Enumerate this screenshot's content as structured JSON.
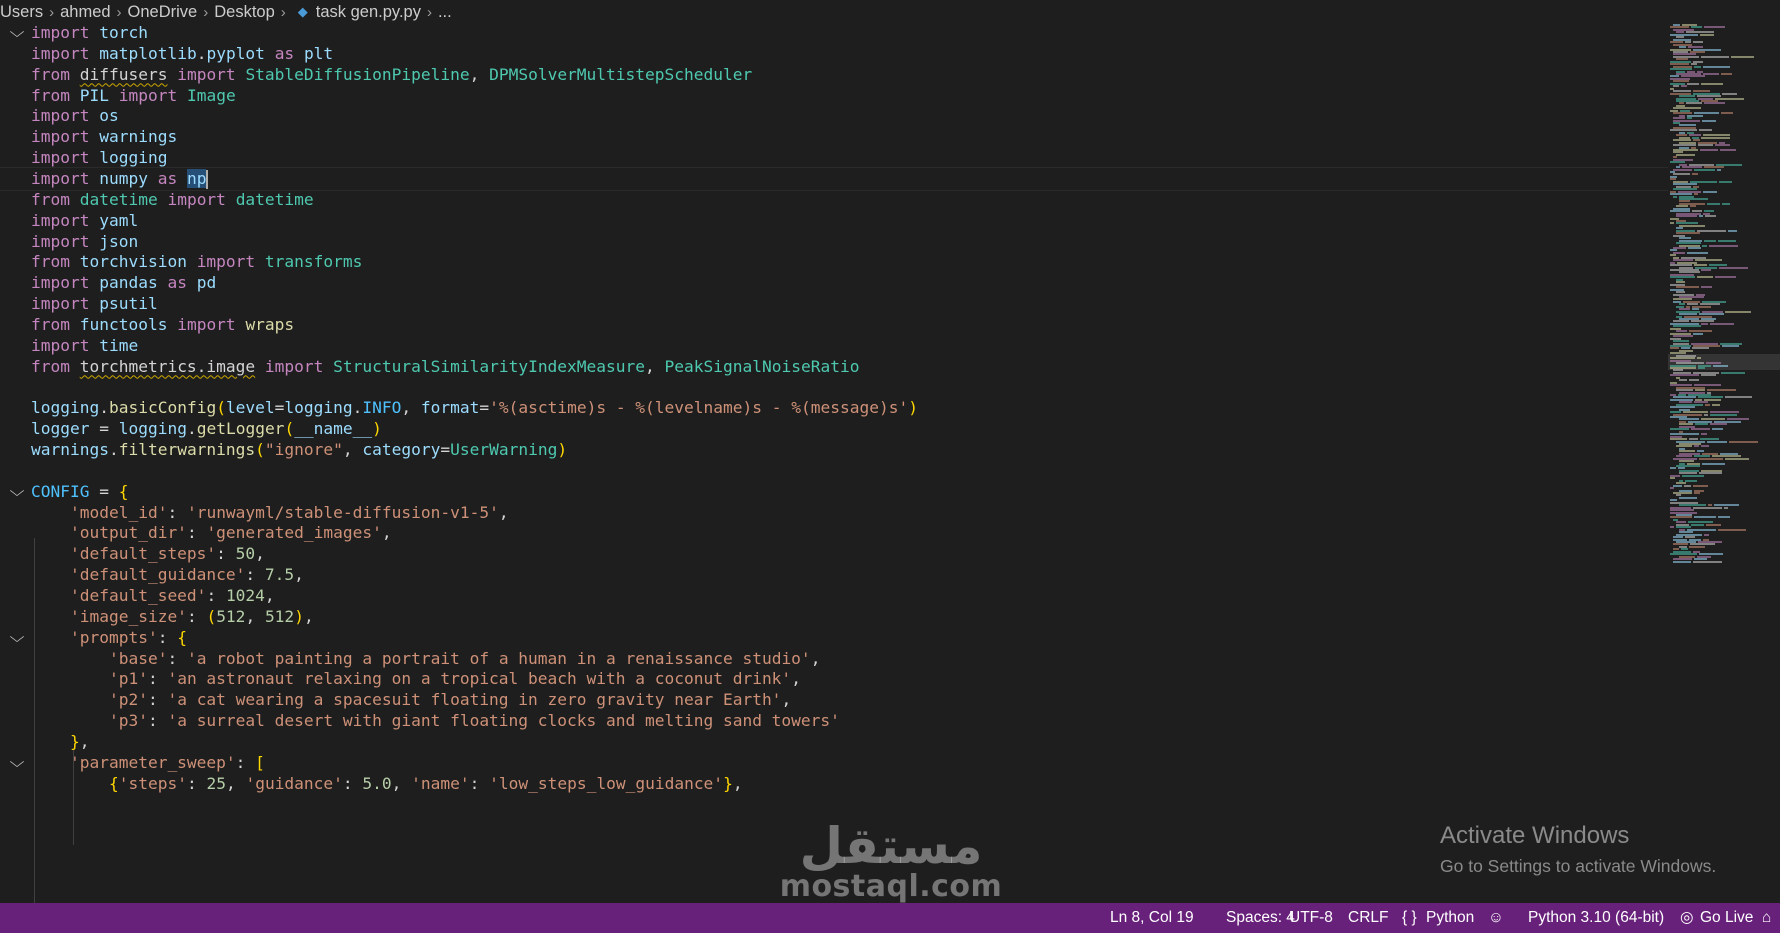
{
  "breadcrumb": {
    "items": [
      "Users",
      "ahmed",
      "OneDrive",
      "Desktop"
    ],
    "file": "task gen.py.py",
    "more": "..."
  },
  "code_lines": [
    "import torch",
    "import matplotlib.pyplot as plt",
    "from diffusers import StableDiffusionPipeline, DPMSolverMultistepScheduler",
    "from PIL import Image",
    "import os",
    "import warnings",
    "import logging",
    "import numpy as np",
    "from datetime import datetime",
    "import yaml",
    "import json",
    "from torchvision import transforms",
    "import pandas as pd",
    "import psutil",
    "from functools import wraps",
    "import time",
    "from torchmetrics.image import StructuralSimilarityIndexMeasure, PeakSignalNoiseRatio",
    "",
    "logging.basicConfig(level=logging.INFO, format='%(asctime)s - %(levelname)s - %(message)s')",
    "logger = logging.getLogger(__name__)",
    "warnings.filterwarnings(\"ignore\", category=UserWarning)",
    "",
    "CONFIG = {",
    "    'model_id': 'runwayml/stable-diffusion-v1-5',",
    "    'output_dir': 'generated_images',",
    "    'default_steps': 50,",
    "    'default_guidance': 7.5,",
    "    'default_seed': 1024,",
    "    'image_size': (512, 512),",
    "    'prompts': {",
    "        'base': 'a robot painting a portrait of a human in a renaissance studio',",
    "        'p1': 'an astronaut relaxing on a tropical beach with a coconut drink',",
    "        'p2': 'a cat wearing a spacesuit floating in zero gravity near Earth',",
    "        'p3': 'a surreal desert with giant floating clocks and melting sand towers'",
    "    },",
    "    'parameter_sweep': [",
    "        {'steps': 25, 'guidance': 5.0, 'name': 'low_steps_low_guidance'},"
  ],
  "current_line_number": 8,
  "fold_lines": [
    1,
    23,
    30,
    36
  ],
  "status": {
    "ln_col": "Ln 8, Col 19",
    "spaces": "Spaces: 4",
    "encoding": "UTF-8",
    "eol": "CRLF",
    "language_icon": "{ }",
    "language": "Python",
    "interpreter": "Python 3.10 (64-bit)",
    "go_live": "Go Live"
  },
  "activation": {
    "title": "Activate Windows",
    "subtitle": "Go to Settings to activate Windows."
  },
  "watermark": {
    "arabic": "مستقل",
    "latin": "mostaql.com"
  },
  "colors": {
    "editor_bg": "#1e1e1e",
    "statusbar_bg": "#68217a",
    "keyword": "#c586c0",
    "variable": "#9cdcfe",
    "class": "#4ec9b0",
    "function": "#dcdcaa",
    "string": "#ce9178",
    "number": "#b5cea8"
  }
}
